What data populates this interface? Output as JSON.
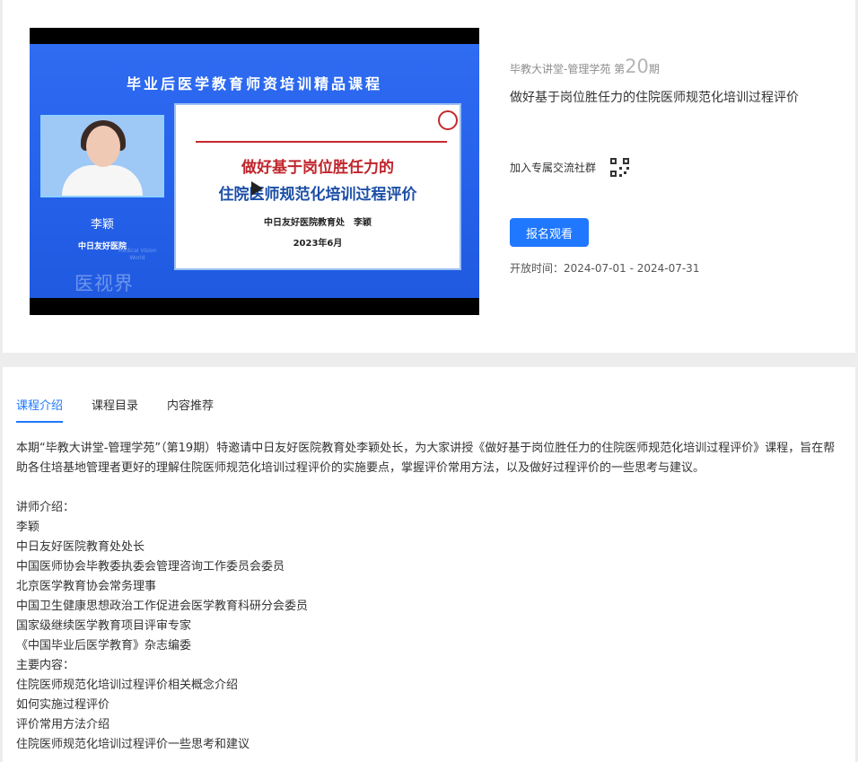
{
  "video": {
    "slide_header": "毕业后医学教育师资培训精品课程",
    "speaker_name": "李颖",
    "speaker_hospital": "中日友好医院",
    "watermark": "医视界",
    "watermark_en": "Medical Vision World",
    "slide_title_line1": "做好基于岗位胜任力的",
    "slide_title_line2": "住院医师规范化培训过程评价",
    "slide_meta_1": "中日友好医院教育处　李颖",
    "slide_meta_2": "2023年6月"
  },
  "course": {
    "series": "毕教大讲堂-管理学苑",
    "issue_prefix": "第",
    "issue_number": "20",
    "issue_suffix": "期",
    "title": "做好基于岗位胜任力的住院医师规范化培训过程评价",
    "join_group_label": "加入专属交流社群",
    "signup_label": "报名观看",
    "open_time_label": "开放时间：",
    "open_time_value": "2024-07-01 - 2024-07-31"
  },
  "tabs": [
    "课程介绍",
    "课程目录",
    "内容推荐"
  ],
  "intro": {
    "paragraph": "本期“毕教大讲堂-管理学苑”（第19期）特邀请中日友好医院教育处李颖处长，为大家讲授《做好基于岗位胜任力的住院医师规范化培训过程评价》课程，旨在帮助各住培基地管理者更好的理解住院医师规范化培训过程评价的实施要点，掌握评价常用方法，以及做好过程评价的一些思考与建议。",
    "lines": [
      "讲师介绍：",
      "李颖",
      "中日友好医院教育处处长",
      "中国医师协会毕教委执委会管理咨询工作委员会委员",
      "北京医学教育协会常务理事",
      "中国卫生健康思想政治工作促进会医学教育科研分会委员",
      "国家级继续医学教育项目评审专家",
      "《中国毕业后医学教育》杂志编委",
      "主要内容：",
      "住院医师规范化培训过程评价相关概念介绍",
      "如何实施过程评价",
      "评价常用方法介绍",
      "住院医师规范化培训过程评价一些思考和建议"
    ]
  }
}
